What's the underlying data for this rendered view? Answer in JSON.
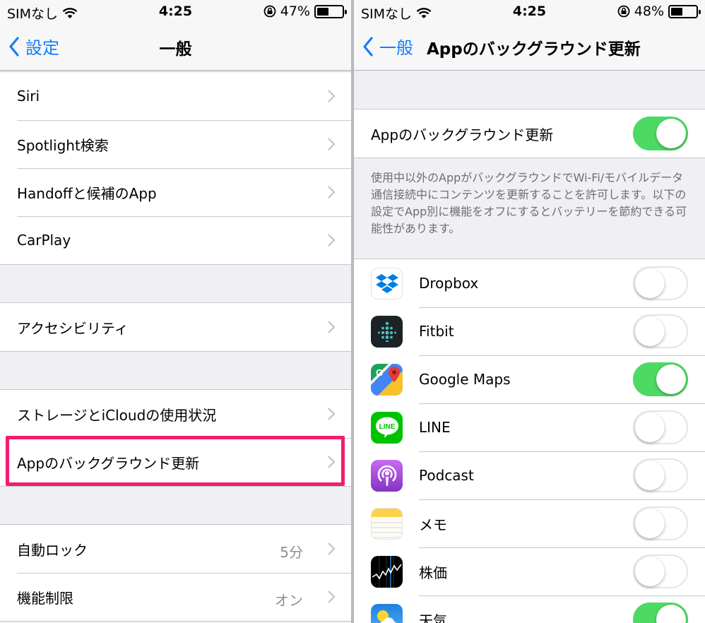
{
  "left": {
    "status": {
      "carrier": "SIMなし",
      "time": "4:25",
      "battery": "47%",
      "battery_level": 0.47
    },
    "nav": {
      "back_label": "設定",
      "title": "一般"
    },
    "groups": [
      {
        "items": [
          "Siri",
          "Spotlight検索",
          "Handoffと候補のApp",
          "CarPlay"
        ]
      },
      {
        "items": [
          "アクセシビリティ"
        ]
      },
      {
        "items": [
          "ストレージとiCloudの使用状況",
          "Appのバックグラウンド更新"
        ]
      },
      {
        "items": [
          {
            "label": "自動ロック",
            "value": "5分"
          },
          {
            "label": "機能制限",
            "value": "オン"
          }
        ]
      }
    ]
  },
  "right": {
    "status": {
      "carrier": "SIMなし",
      "time": "4:25",
      "battery": "48%",
      "battery_level": 0.48
    },
    "nav": {
      "back_label": "一般",
      "title": "Appのバックグラウンド更新"
    },
    "master": {
      "label": "Appのバックグラウンド更新",
      "on": true
    },
    "footer": "使用中以外のAppがバックグラウンドでWi-Fi/モバイルデータ通信接続中にコンテンツを更新することを許可します。以下の設定でApp別に機能をオフにするとバッテリーを節約できる可能性があります。",
    "apps": [
      {
        "name": "Dropbox",
        "icon": "dropbox-icon",
        "on": false
      },
      {
        "name": "Fitbit",
        "icon": "fitbit-icon",
        "on": false
      },
      {
        "name": "Google Maps",
        "icon": "google-maps-icon",
        "on": true
      },
      {
        "name": "LINE",
        "icon": "line-icon",
        "on": false
      },
      {
        "name": "Podcast",
        "icon": "podcast-icon",
        "on": false
      },
      {
        "name": "メモ",
        "icon": "notes-icon",
        "on": false
      },
      {
        "name": "株価",
        "icon": "stocks-icon",
        "on": false
      },
      {
        "name": "天気",
        "icon": "weather-icon",
        "on": true
      }
    ]
  },
  "colors": {
    "accent": "#147efb",
    "toggle_on": "#4cd964",
    "highlight": "#f01f6c"
  }
}
